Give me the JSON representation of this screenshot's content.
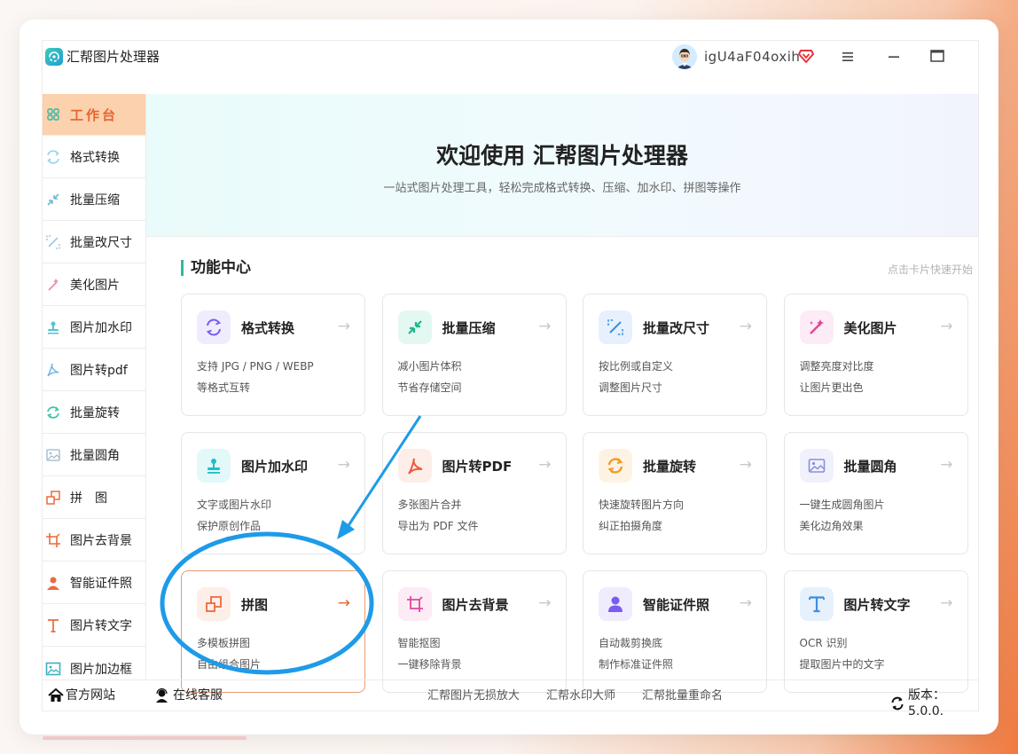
{
  "app": {
    "title": "汇帮图片处理器"
  },
  "user": {
    "name": "igU4aF04oxih"
  },
  "sidebar": {
    "items": [
      {
        "label": "工作台",
        "icon": "grid-icon"
      },
      {
        "label": "格式转换",
        "icon": "convert-icon"
      },
      {
        "label": "批量压缩",
        "icon": "compress-icon"
      },
      {
        "label": "批量改尺寸",
        "icon": "resize-icon"
      },
      {
        "label": "美化图片",
        "icon": "beautify-icon"
      },
      {
        "label": "图片加水印",
        "icon": "watermark-icon"
      },
      {
        "label": "图片转pdf",
        "icon": "pdf-icon"
      },
      {
        "label": "批量旋转",
        "icon": "rotate-icon"
      },
      {
        "label": "批量圆角",
        "icon": "round-corner-icon"
      },
      {
        "label": "拼　图",
        "icon": "collage-icon"
      },
      {
        "label": "图片去背景",
        "icon": "crop-icon"
      },
      {
        "label": "智能证件照",
        "icon": "person-icon"
      },
      {
        "label": "图片转文字",
        "icon": "text-icon"
      },
      {
        "label": "图片加边框",
        "icon": "frame-icon"
      }
    ]
  },
  "banner": {
    "title": "欢迎使用 汇帮图片处理器",
    "subtitle": "一站式图片处理工具，轻松完成格式转换、压缩、加水印、拼图等操作"
  },
  "section": {
    "title": "功能中心",
    "hint": "点击卡片快速开始"
  },
  "cards": [
    {
      "title": "格式转换",
      "desc1": "支持 JPG / PNG / WEBP",
      "desc2": "等格式互转",
      "icon": "convert-icon",
      "arrow": "→",
      "color": "#7b5cf0",
      "bg": "#f0ecfe"
    },
    {
      "title": "批量压缩",
      "desc1": "减小图片体积",
      "desc2": "节省存储空间",
      "icon": "compress-icon",
      "arrow": "→",
      "color": "#22b58f",
      "bg": "#e3f8f2"
    },
    {
      "title": "批量改尺寸",
      "desc1": "按比例或自定义",
      "desc2": "调整图片尺寸",
      "icon": "resize-icon",
      "arrow": "→",
      "color": "#3d8fe0",
      "bg": "#e6f1fd"
    },
    {
      "title": "美化图片",
      "desc1": "调整亮度对比度",
      "desc2": "让图片更出色",
      "icon": "beautify-icon",
      "arrow": "→",
      "color": "#e0489a",
      "bg": "#fdebf5"
    },
    {
      "title": "图片加水印",
      "desc1": "文字或图片水印",
      "desc2": "保护原创作品",
      "icon": "watermark-icon",
      "arrow": "→",
      "color": "#1fbfc4",
      "bg": "#e2f8f9"
    },
    {
      "title": "图片转PDF",
      "desc1": "多张图片合并",
      "desc2": "导出为 PDF 文件",
      "icon": "pdf-icon",
      "arrow": "→",
      "color": "#ec5a3c",
      "bg": "#fdeeea"
    },
    {
      "title": "批量旋转",
      "desc1": "快速旋转图片方向",
      "desc2": "纠正拍摄角度",
      "icon": "rotate-icon",
      "arrow": "→",
      "color": "#f09a2a",
      "bg": "#fef3e3"
    },
    {
      "title": "批量圆角",
      "desc1": "一键生成圆角图片",
      "desc2": "美化边角效果",
      "icon": "round-corner-icon",
      "arrow": "→",
      "color": "#8a8fd8",
      "bg": "#f1f1fc"
    },
    {
      "title": "拼图",
      "desc1": "多模板拼图",
      "desc2": "自由组合图片",
      "icon": "collage-icon",
      "arrow": "→",
      "color": "#ec6a3d",
      "bg": "#fdefe8"
    },
    {
      "title": "图片去背景",
      "desc1": "智能抠图",
      "desc2": "一键移除背景",
      "icon": "crop-icon",
      "arrow": "→",
      "color": "#e0489a",
      "bg": "#fdebf5"
    },
    {
      "title": "智能证件照",
      "desc1": "自动裁剪换底",
      "desc2": "制作标准证件照",
      "icon": "person-icon",
      "arrow": "→",
      "color": "#7b5cf0",
      "bg": "#f0ecfe"
    },
    {
      "title": "图片转文字",
      "desc1": "OCR 识别",
      "desc2": "提取图片中的文字",
      "icon": "text-icon",
      "arrow": "→",
      "color": "#3d8fe0",
      "bg": "#e6f1fd"
    }
  ],
  "footer": {
    "official_site": "官方网站",
    "online_service": "在线客服",
    "links": [
      "汇帮图片无损放大",
      "汇帮水印大师",
      "汇帮批量重命名"
    ],
    "version": "版本：5.0.0."
  },
  "colors": {
    "accent": "#e5662d",
    "teal": "#2fb8a5",
    "annotation": "#1e9be8"
  }
}
